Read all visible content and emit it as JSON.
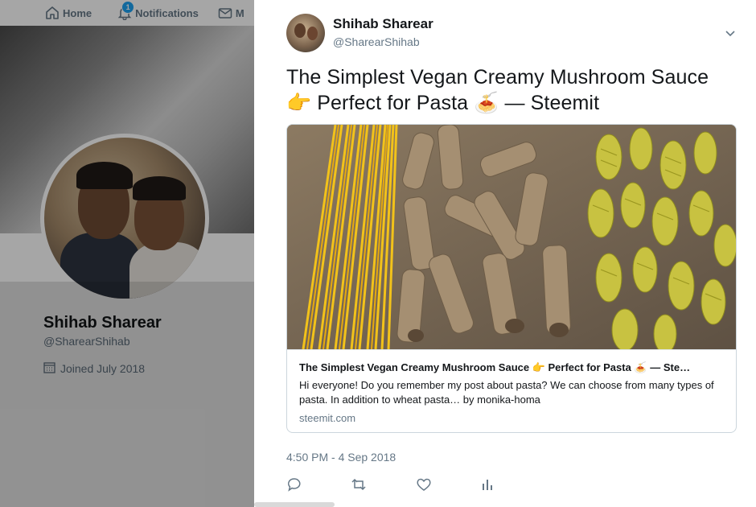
{
  "nav": {
    "home_label": "Home",
    "notifications_label": "Notifications",
    "notifications_badge": "1",
    "messages_label_partial": "M"
  },
  "profile": {
    "name": "Shihab Sharear",
    "handle": "@SharearShihab",
    "joined": "Joined July 2018"
  },
  "tweet": {
    "author_name": "Shihab Sharear",
    "author_handle": "@SharearShihab",
    "text_line1": "The Simplest Vegan Creamy Mushroom Sauce",
    "text_line2_emoji1": "👉",
    "text_line2": "Perfect for Pasta",
    "text_line2_emoji2": "🍝",
    "text_line2_tail": "— Steemit",
    "timestamp": "4:50 PM - 4 Sep 2018"
  },
  "card": {
    "title": "The Simplest Vegan Creamy Mushroom Sauce 👉 Perfect for Pasta 🍝 — Ste…",
    "description": "Hi everyone! Do you remember my post about pasta? We can choose from many types of pasta. In addition to wheat pasta… by monika-homa",
    "domain": "steemit.com"
  },
  "colors": {
    "accent": "#1da1f2",
    "text_primary": "#14171a",
    "text_secondary": "#657786",
    "border": "#ccd6dd"
  },
  "icons": [
    "home-icon",
    "bell-icon",
    "envelope-icon",
    "calendar-icon",
    "chevron-down-icon",
    "reply-icon",
    "retweet-icon",
    "like-icon",
    "analytics-icon"
  ]
}
